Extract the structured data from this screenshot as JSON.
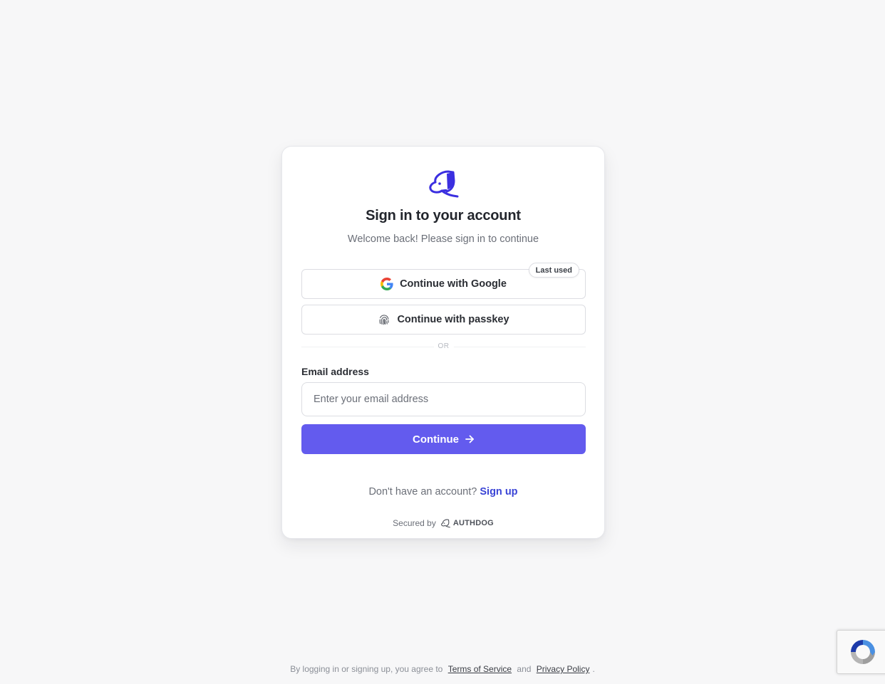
{
  "card": {
    "title": "Sign in to your account",
    "subtitle": "Welcome back! Please sign in to continue",
    "google_button": {
      "label": "Continue with Google",
      "badge": "Last used",
      "icon": "google-icon"
    },
    "passkey_button": {
      "label": "Continue with passkey",
      "icon": "fingerprint-icon"
    },
    "divider_text": "OR",
    "email": {
      "label": "Email address",
      "placeholder": "Enter your email address",
      "value": ""
    },
    "continue_button": {
      "label": "Continue",
      "icon": "arrow-right-icon"
    },
    "signup": {
      "prompt": "Don't have an account?",
      "link": "Sign up"
    },
    "secured": {
      "text": "Secured by",
      "brand": "AUTHDOG"
    }
  },
  "footer": {
    "prefix": "By logging in or signing up, you agree to",
    "terms": "Terms of Service",
    "and": "and",
    "privacy": "Privacy Policy",
    "suffix": "."
  },
  "colors": {
    "primary": "#635bee",
    "link": "#3a44d6",
    "background": "#f7f7f8",
    "logo": "#3b2fe0"
  }
}
